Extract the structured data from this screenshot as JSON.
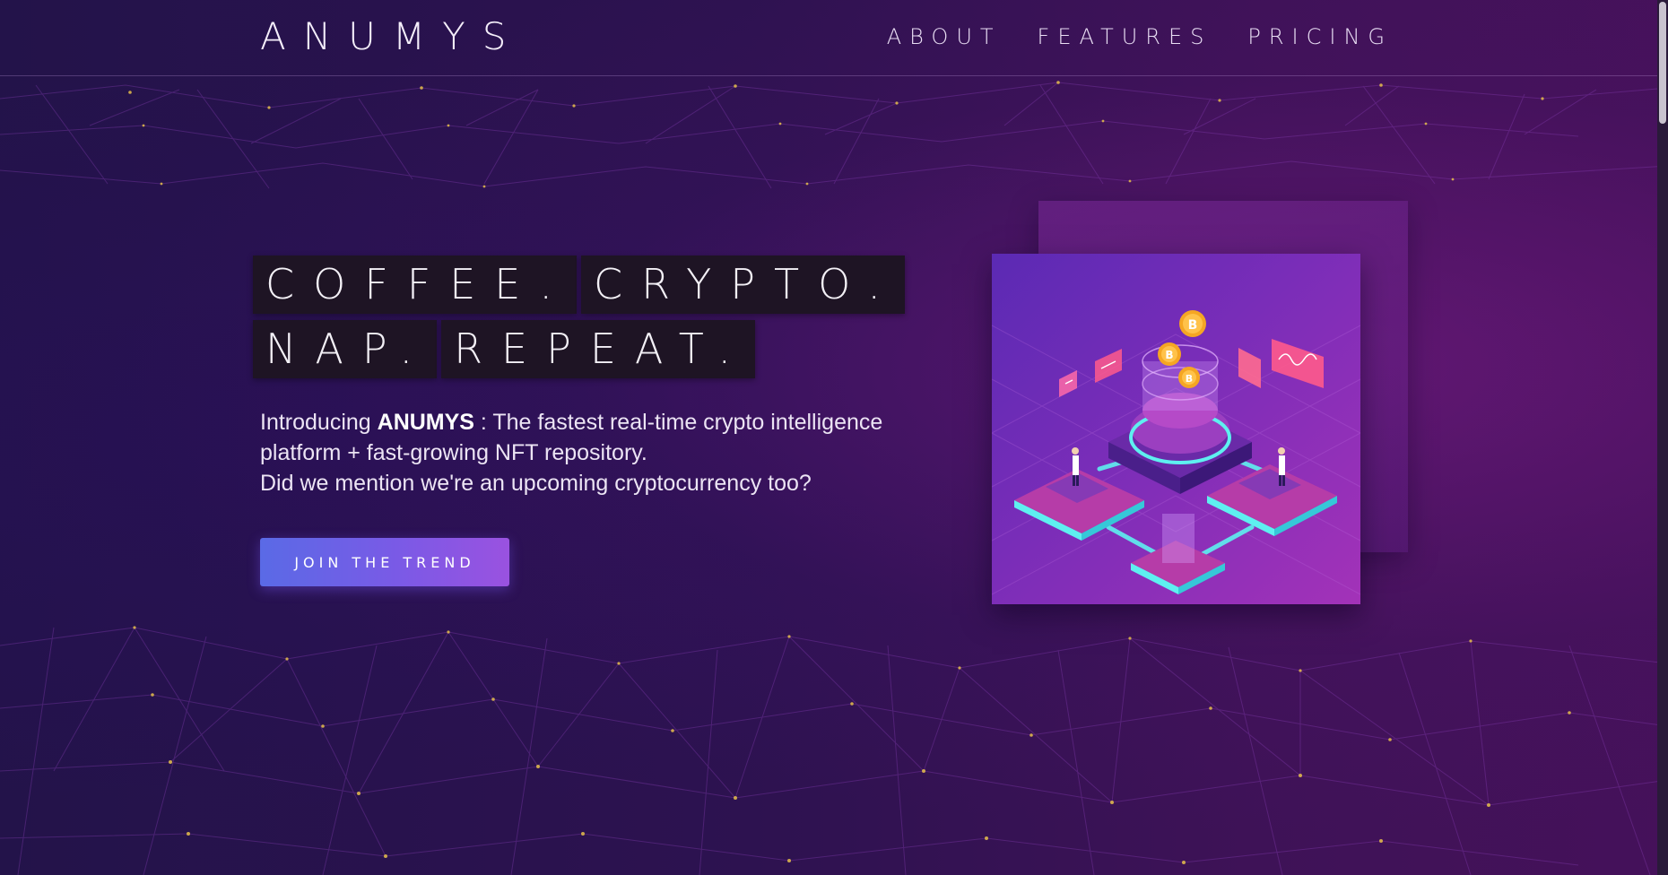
{
  "brand": {
    "logo_text": "ANUMYS"
  },
  "nav": {
    "items": [
      {
        "label": "ABOUT"
      },
      {
        "label": "FEATURES"
      },
      {
        "label": "PRICING"
      }
    ]
  },
  "hero": {
    "headline_words": [
      "COFFEE.",
      "CRYPTO.",
      "NAP.",
      "REPEAT."
    ],
    "intro_prefix": "Introducing ",
    "intro_brand": "ANUMYS",
    "intro_line1_rest": " : The fastest real-time crypto intelligence",
    "intro_line2": "platform + fast-growing NFT repository.",
    "intro_line3": "Did we mention we're an upcoming cryptocurrency too?",
    "cta_label": "JOIN THE TREND"
  },
  "illustration": {
    "coin_symbol": "B",
    "icon": "isometric-blockchain-illustration"
  },
  "colors": {
    "background": "#2a0f44",
    "accent_start": "#5a6ae6",
    "accent_end": "#9a52e0",
    "neon": "#5ef0f0",
    "coin": "#f5a623"
  }
}
